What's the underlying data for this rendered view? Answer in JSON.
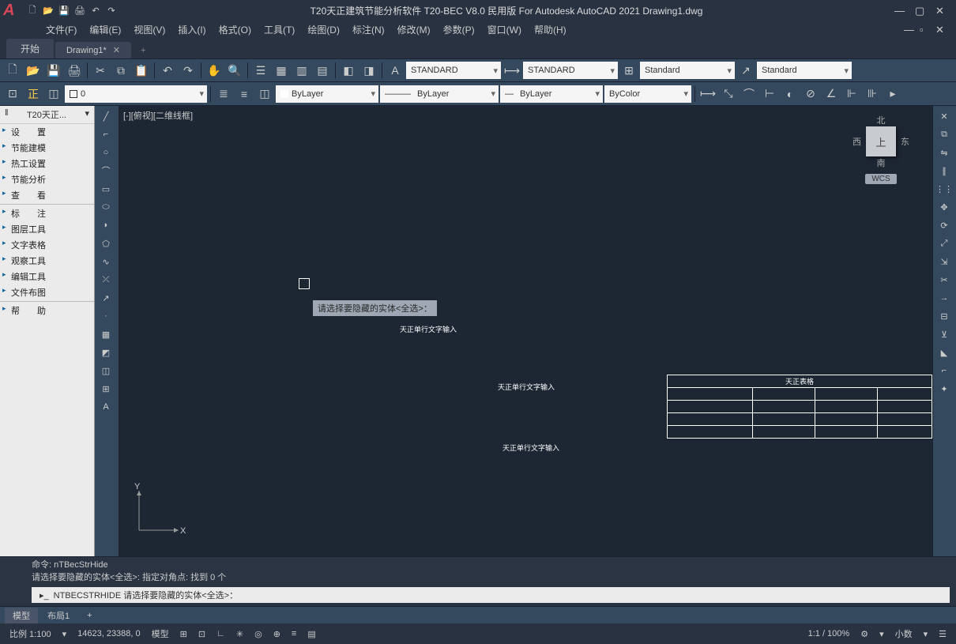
{
  "title": "T20天正建筑节能分析软件 T20-BEC V8.0 民用版 For Autodesk AutoCAD 2021    Drawing1.dwg",
  "menu": [
    "文件(F)",
    "编辑(E)",
    "视图(V)",
    "插入(I)",
    "格式(O)",
    "工具(T)",
    "绘图(D)",
    "标注(N)",
    "修改(M)",
    "参数(P)",
    "窗口(W)",
    "帮助(H)"
  ],
  "tabs": {
    "start": "开始",
    "file": "Drawing1*"
  },
  "style_panels": {
    "text": "STANDARD",
    "dim": "STANDARD",
    "table": "Standard",
    "mleader": "Standard"
  },
  "layer_panels": {
    "layer": "0",
    "color": "ByLayer",
    "ltype": "ByLayer",
    "lweight": "ByLayer",
    "plot": "ByColor"
  },
  "sidebar": {
    "title": "T20天正...",
    "items": [
      "设　　置",
      "节能建模",
      "热工设置",
      "节能分析",
      "查　　看"
    ],
    "items2": [
      "标　　注",
      "图层工具",
      "文字表格",
      "观察工具",
      "编辑工具",
      "文件布图"
    ],
    "items3": [
      "帮　　助"
    ]
  },
  "canvas": {
    "viewport": "[-][俯视][二维线框]",
    "prompt": "请选择要隐藏的实体<全选>：",
    "t1": "天正单行文字输入",
    "t2": "天正单行文字输入",
    "t3": "天正单行文字输入",
    "table_header": "天正表格"
  },
  "viewcube": {
    "n": "北",
    "s": "南",
    "w": "西",
    "e": "东",
    "top": "上",
    "wcs": "WCS"
  },
  "ucs": {
    "x": "X",
    "y": "Y"
  },
  "cmd": {
    "l1": "命令: nTBecStrHide",
    "l2": "请选择要隐藏的实体<全选>: 指定对角点: 找到 0 个",
    "prompt": "NTBECSTRHIDE 请选择要隐藏的实体<全选>："
  },
  "bottom_tabs": {
    "model": "模型",
    "layout": "布局1"
  },
  "status": {
    "scale": "比例 1:100",
    "coords": "14623, 23388, 0",
    "model": "模型",
    "zoom": "1:1 / 100%",
    "dec": "小数"
  },
  "icons": {
    "new": "🗋",
    "open": "📂",
    "save": "💾",
    "saveas": "🖨",
    "undo": "↶",
    "redo": "↷",
    "line": "╱",
    "circle": "○",
    "arc": "⌒",
    "rect": "▭",
    "poly": "⬠",
    "ellipse": "⬭",
    "hatch": "▦",
    "text": "A",
    "table": "⊞",
    "point": "·",
    "spline": "∿",
    "region": "◫",
    "move": "✥",
    "copy": "⧉",
    "rotate": "⟳",
    "mirror": "⇋",
    "scale": "⤢",
    "trim": "✂",
    "extend": "→",
    "offset": "∥",
    "array": "⋮⋮",
    "erase": "✕",
    "fillet": "⌐",
    "explode": "✦",
    "layer": "≡",
    "props": "☰",
    "grid": "⊞",
    "snap": "⊡",
    "ortho": "∟",
    "polar": "✳",
    "osnap": "◎",
    "dyn": "⊕",
    "lwt": "≡",
    "qp": "▤"
  }
}
